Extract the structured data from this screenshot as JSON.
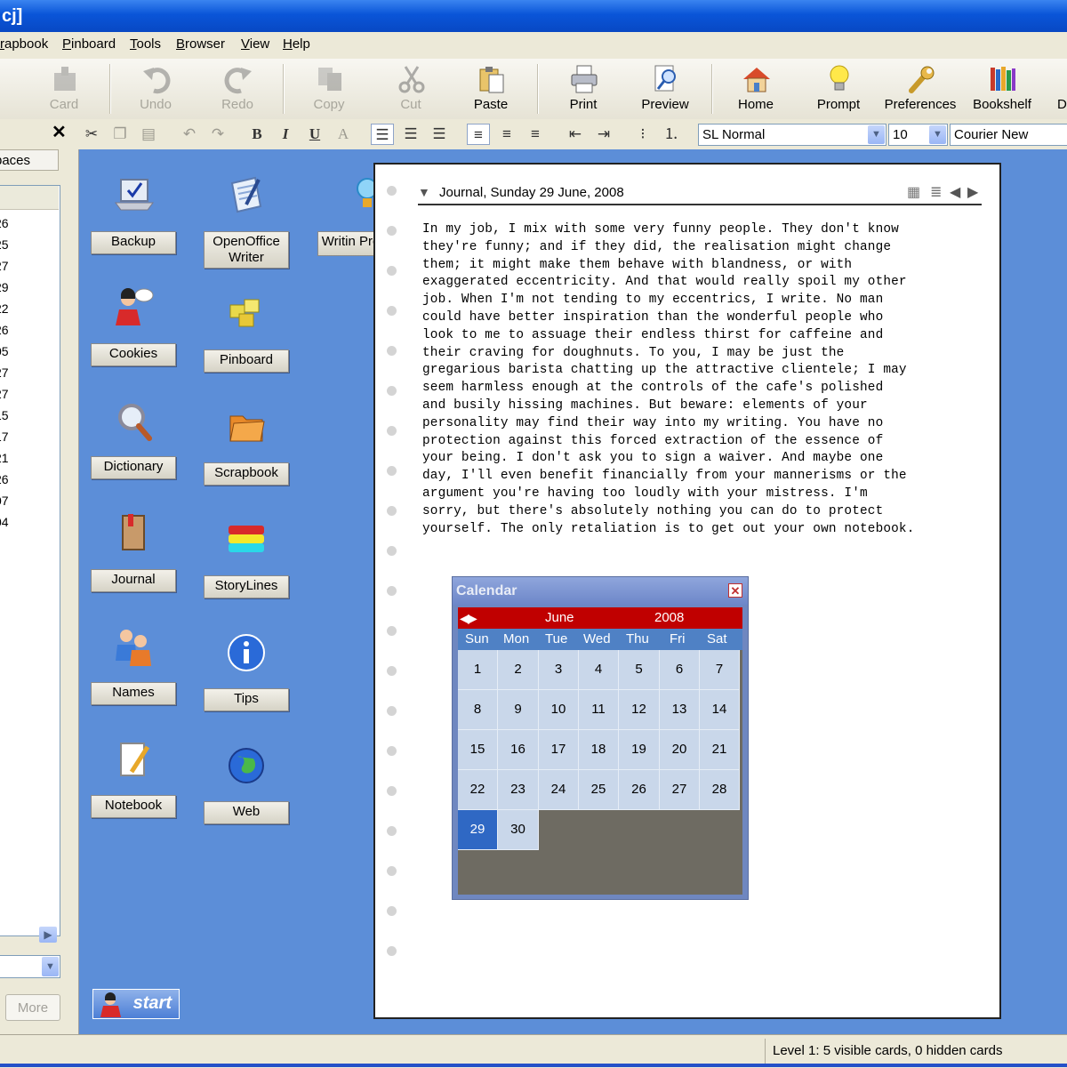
{
  "window": {
    "title": "cj]"
  },
  "menu": [
    "rapbook",
    "Pinboard",
    "Tools",
    "Browser",
    "View",
    "Help"
  ],
  "toolbar": {
    "card": "Card",
    "undo": "Undo",
    "redo": "Redo",
    "copy": "Copy",
    "cut": "Cut",
    "paste": "Paste",
    "print": "Print",
    "preview": "Preview",
    "home": "Home",
    "prompt": "Prompt",
    "preferences": "Preferences",
    "bookshelf": "Bookshelf",
    "more": "D"
  },
  "format": {
    "bold": "B",
    "italic": "I",
    "underline": "U",
    "font_color": "A",
    "style": "SL Normal",
    "size": "10",
    "font": "Courier New"
  },
  "left_panel": {
    "close": "✕",
    "tab": "paces",
    "numbers": [
      "26",
      "25",
      "27",
      "29",
      "22",
      "26",
      "05",
      "27",
      "27",
      "15",
      "17",
      "21",
      "26",
      "07",
      "04"
    ],
    "more": "More"
  },
  "desktop": {
    "backup": "Backup",
    "openoffice": "OpenOffice Writer",
    "writing_prompt": "Writin Promp",
    "cookies": "Cookies",
    "pinboard": "Pinboard",
    "dictionary": "Dictionary",
    "scrapbook": "Scrapbook",
    "journal": "Journal",
    "storylines": "StoryLines",
    "names": "Names",
    "tips": "Tips",
    "notebook": "Notebook",
    "web": "Web",
    "start": "start"
  },
  "card": {
    "title": "Journal, Sunday 29 June, 2008",
    "body": "In my job, I mix with some very funny people. They don't know\nthey're funny; and if they did, the realisation might change\nthem; it might make them behave with blandness, or with\nexaggerated eccentricity. And that would really spoil my other\njob. When I'm not tending to my eccentrics, I write. No man\ncould have better inspiration than the wonderful people who\nlook to me to assuage their endless thirst for caffeine and\ntheir craving for doughnuts. To you, I may be just the\ngregarious barista chatting up the attractive clientele; I may\nseem harmless enough at the controls of the cafe's polished\nand busily hissing machines. But beware: elements of your\npersonality may find their way into my writing. You have no\nprotection against this forced extraction of the essence of\nyour being. I don't ask you to sign a waiver. And maybe one\nday, I'll even benefit financially from your mannerisms or the\nargument you're having too loudly with your mistress. I'm\nsorry, but there's absolutely nothing you can do to protect\nyourself. The only retaliation is to get out your own notebook."
  },
  "calendar": {
    "title": "Calendar",
    "month": "June",
    "year": "2008",
    "weekdays": [
      "Sun",
      "Mon",
      "Tue",
      "Wed",
      "Thu",
      "Fri",
      "Sat"
    ],
    "days": [
      "1",
      "2",
      "3",
      "4",
      "5",
      "6",
      "7",
      "8",
      "9",
      "10",
      "11",
      "12",
      "13",
      "14",
      "15",
      "16",
      "17",
      "18",
      "19",
      "20",
      "21",
      "22",
      "23",
      "24",
      "25",
      "26",
      "27",
      "28",
      "29",
      "30"
    ],
    "selected": "29"
  },
  "status": {
    "text": "Level 1: 5 visible cards, 0 hidden cards"
  }
}
